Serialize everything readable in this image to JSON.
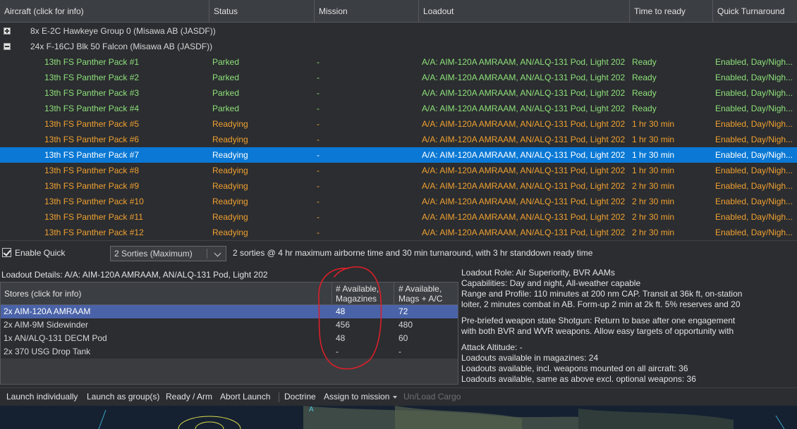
{
  "columns": [
    "Aircraft (click for info)",
    "Status",
    "Mission",
    "Loadout",
    "Time to ready",
    "Quick Turnaround"
  ],
  "groups": [
    {
      "label": "8x E-2C Hawkeye Group 0 (Misawa AB (JASDF))",
      "expanded": false
    },
    {
      "label": "24x F-16CJ Blk 50 Falcon (Misawa AB (JASDF))",
      "expanded": true
    }
  ],
  "aircraft": [
    {
      "name": "13th FS Panther Pack #1",
      "status": "Parked",
      "mission": "-",
      "loadout": "A/A: AIM-120A AMRAAM, AN/ALQ-131 Pod, Light 202",
      "ready": "Ready",
      "qt": "Enabled, Day/Nigh...",
      "state": "ready"
    },
    {
      "name": "13th FS Panther Pack #2",
      "status": "Parked",
      "mission": "-",
      "loadout": "A/A: AIM-120A AMRAAM, AN/ALQ-131 Pod, Light 202",
      "ready": "Ready",
      "qt": "Enabled, Day/Nigh...",
      "state": "ready"
    },
    {
      "name": "13th FS Panther Pack #3",
      "status": "Parked",
      "mission": "-",
      "loadout": "A/A: AIM-120A AMRAAM, AN/ALQ-131 Pod, Light 202",
      "ready": "Ready",
      "qt": "Enabled, Day/Nigh...",
      "state": "ready"
    },
    {
      "name": "13th FS Panther Pack #4",
      "status": "Parked",
      "mission": "-",
      "loadout": "A/A: AIM-120A AMRAAM, AN/ALQ-131 Pod, Light 202",
      "ready": "Ready",
      "qt": "Enabled, Day/Nigh...",
      "state": "ready"
    },
    {
      "name": "13th FS Panther Pack #5",
      "status": "Readying",
      "mission": "-",
      "loadout": "A/A: AIM-120A AMRAAM, AN/ALQ-131 Pod, Light 202",
      "ready": "1 hr 30 min",
      "qt": "Enabled, Day/Nigh...",
      "state": "readying"
    },
    {
      "name": "13th FS Panther Pack #6",
      "status": "Readying",
      "mission": "-",
      "loadout": "A/A: AIM-120A AMRAAM, AN/ALQ-131 Pod, Light 202",
      "ready": "1 hr 30 min",
      "qt": "Enabled, Day/Nigh...",
      "state": "readying"
    },
    {
      "name": "13th FS Panther Pack #7",
      "status": "Readying",
      "mission": "-",
      "loadout": "A/A: AIM-120A AMRAAM, AN/ALQ-131 Pod, Light 202",
      "ready": "1 hr 30 min",
      "qt": "Enabled, Day/Nigh...",
      "state": "selected"
    },
    {
      "name": "13th FS Panther Pack #8",
      "status": "Readying",
      "mission": "-",
      "loadout": "A/A: AIM-120A AMRAAM, AN/ALQ-131 Pod, Light 202",
      "ready": "1 hr 30 min",
      "qt": "Enabled, Day/Nigh...",
      "state": "readying"
    },
    {
      "name": "13th FS Panther Pack #9",
      "status": "Readying",
      "mission": "-",
      "loadout": "A/A: AIM-120A AMRAAM, AN/ALQ-131 Pod, Light 202",
      "ready": "2 hr 30 min",
      "qt": "Enabled, Day/Nigh...",
      "state": "readying"
    },
    {
      "name": "13th FS Panther Pack #10",
      "status": "Readying",
      "mission": "-",
      "loadout": "A/A: AIM-120A AMRAAM, AN/ALQ-131 Pod, Light 202",
      "ready": "2 hr 30 min",
      "qt": "Enabled, Day/Nigh...",
      "state": "readying"
    },
    {
      "name": "13th FS Panther Pack #11",
      "status": "Readying",
      "mission": "-",
      "loadout": "A/A: AIM-120A AMRAAM, AN/ALQ-131 Pod, Light 202",
      "ready": "2 hr 30 min",
      "qt": "Enabled, Day/Nigh...",
      "state": "readying"
    },
    {
      "name": "13th FS Panther Pack #12",
      "status": "Readying",
      "mission": "-",
      "loadout": "A/A: AIM-120A AMRAAM, AN/ALQ-131 Pod, Light 202",
      "ready": "2 hr 30 min",
      "qt": "Enabled, Day/Nigh...",
      "state": "readying"
    }
  ],
  "quick": {
    "enable_label": "Enable Quick",
    "enabled": true,
    "sorties_value": "2 Sorties (Maximum)",
    "description": "2 sorties @ 4 hr maximum airborne time and 30 min turnaround, with 3 hr standdown ready time"
  },
  "loadout_details_title": "Loadout Details: A/A: AIM-120A AMRAAM, AN/ALQ-131 Pod, Light 202",
  "stores": {
    "headers": {
      "name": "Stores (click for info)",
      "mag_line1": "# Available,",
      "mag_line2": "Magazines",
      "ac_line1": "# Available,",
      "ac_line2": "Mags + A/C"
    },
    "rows": [
      {
        "name": "2x AIM-120A AMRAAM",
        "mag": "48",
        "ac": "72",
        "selected": true
      },
      {
        "name": "2x AIM-9M Sidewinder",
        "mag": "456",
        "ac": "480",
        "selected": false
      },
      {
        "name": "1x AN/ALQ-131 DECM Pod",
        "mag": "48",
        "ac": "60",
        "selected": false
      },
      {
        "name": "2x 370 USG Drop Tank",
        "mag": "-",
        "ac": "-",
        "selected": false
      }
    ]
  },
  "info": {
    "role": "Loadout Role: Air Superiority, BVR AAMs",
    "capabilities": "Capabilities: Day and night, All-weather capable",
    "range_1": "Range and Profile: 110 minutes at 200 nm CAP. Transit at 36k ft, on-station",
    "range_2": "loiter, 2 minutes combat in AB. Form-up 2 min at 2k ft. 5% reserves and 20",
    "weapon_1": "Pre-briefed weapon state Shotgun: Return to base after one engagement",
    "weapon_2": "with both BVR and WVR weapons. Allow easy targets of opportunity with",
    "attack_alt": "Attack Altitude: -",
    "avail_mag": "Loadouts available in magazines: 24",
    "avail_all": "Loadouts available, incl. weapons mounted on all aircraft: 36",
    "avail_excl": "Loadouts available, same as above excl. optional weapons: 36"
  },
  "toolbar": {
    "launch_individually": "Launch individually",
    "launch_group": "Launch as group(s)",
    "ready_arm": "Ready / Arm",
    "abort_launch": "Abort Launch",
    "doctrine": "Doctrine",
    "assign_mission": "Assign to mission",
    "unload_cargo": "Un/Load Cargo"
  },
  "map_label": "A",
  "colors": {
    "ready": "#8ee07a",
    "readying": "#f0a030",
    "selection": "#0a78d4",
    "annotation": "#d9202a"
  }
}
